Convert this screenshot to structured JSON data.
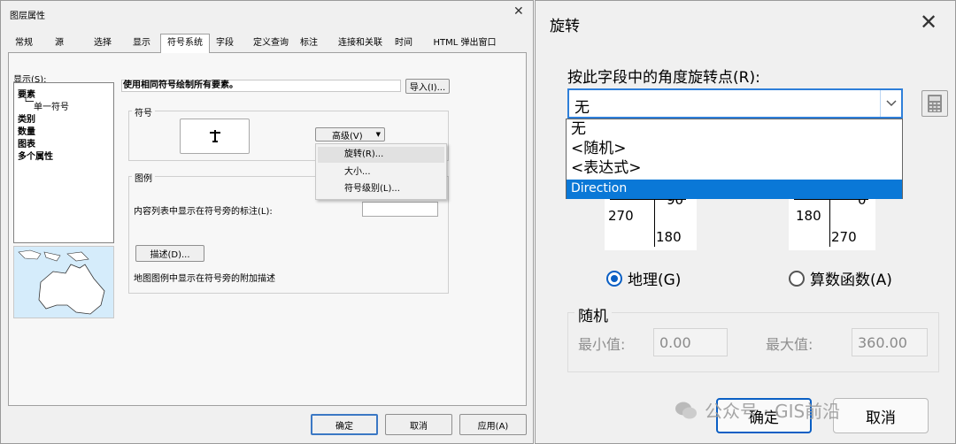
{
  "left_dialog": {
    "title": "图层属性",
    "tabs": [
      "常规",
      "源",
      "选择",
      "显示",
      "符号系统",
      "字段",
      "定义查询",
      "标注",
      "连接和关联",
      "时间",
      "HTML 弹出窗口"
    ],
    "active_tab": "符号系统",
    "show_label": "显示(S):",
    "tree": {
      "features": "要素",
      "single_symbol": "单一符号",
      "categories": "类别",
      "quantities": "数量",
      "charts": "图表",
      "multiple_attributes": "多个属性"
    },
    "heading": "使用相同符号绘制所有要素。",
    "import_button": "导入(I)...",
    "symbol_group": "符号",
    "advanced_button": "高级(V)",
    "menu": {
      "rotation": "旋转(R)...",
      "size": "大小...",
      "symbol_levels": "符号级别(L)..."
    },
    "legend_group": "图例",
    "toc_label": "内容列表中显示在符号旁的标注(L):",
    "description_button": "描述(D)...",
    "description_note": "地图图例中显示在符号旁的附加描述",
    "ok": "确定",
    "cancel": "取消",
    "apply": "应用(A)"
  },
  "right_dialog": {
    "title": "旋转",
    "field_label": "按此字段中的角度旋转点(R):",
    "selected_value": "无",
    "options": [
      "无",
      "<随机>",
      "<表达式>",
      "Direction"
    ],
    "highlighted_option": "Direction",
    "geo_dial": {
      "top": "90",
      "left": "270",
      "bottom": "180"
    },
    "arith_dial": {
      "top": "0",
      "left": "180",
      "bottom": "270"
    },
    "radio_geographic": "地理(G)",
    "radio_arithmetic": "算数函数(A)",
    "random_group": "随机",
    "min_label": "最小值:",
    "min_value": "0.00",
    "max_label": "最大值:",
    "max_value": "360.00",
    "ok": "确定",
    "cancel": "取消"
  },
  "watermark": "公众号 · GIS前沿"
}
